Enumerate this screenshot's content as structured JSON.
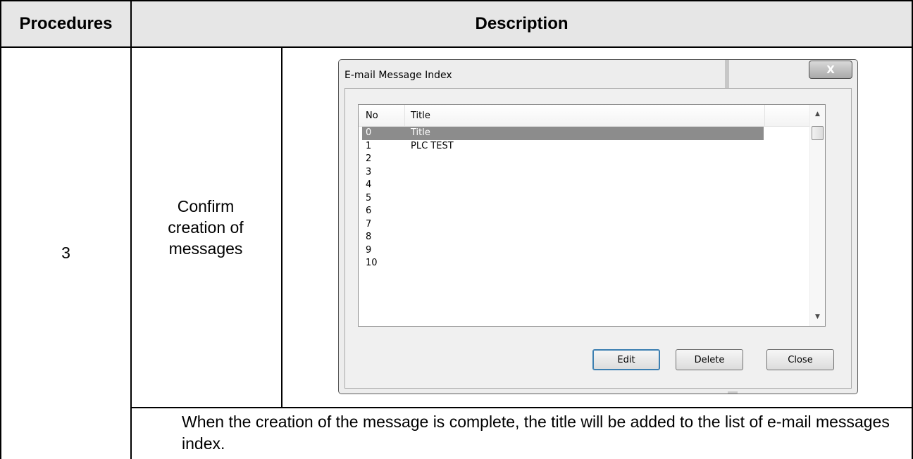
{
  "table": {
    "header_procedures": "Procedures",
    "header_description": "Description",
    "step_number": "3",
    "step_action": "Confirm creation of messages",
    "note": "When the creation of the message is complete, the title will be added to the list of e-mail messages index."
  },
  "dialog": {
    "title": "E-mail Message Index",
    "close_glyph": "X",
    "columns": [
      "No",
      "Title"
    ],
    "rows": [
      {
        "no": "0",
        "title": "Title",
        "selected": true
      },
      {
        "no": "1",
        "title": "PLC TEST"
      },
      {
        "no": "2",
        "title": ""
      },
      {
        "no": "3",
        "title": ""
      },
      {
        "no": "4",
        "title": ""
      },
      {
        "no": "5",
        "title": ""
      },
      {
        "no": "6",
        "title": ""
      },
      {
        "no": "7",
        "title": ""
      },
      {
        "no": "8",
        "title": ""
      },
      {
        "no": "9",
        "title": ""
      },
      {
        "no": "10",
        "title": ""
      }
    ],
    "buttons": {
      "edit": "Edit",
      "delete": "Delete",
      "close": "Close"
    },
    "icons": {
      "scroll_up": "triangle-up-icon",
      "scroll_down": "triangle-down-icon",
      "close": "close-icon"
    }
  }
}
